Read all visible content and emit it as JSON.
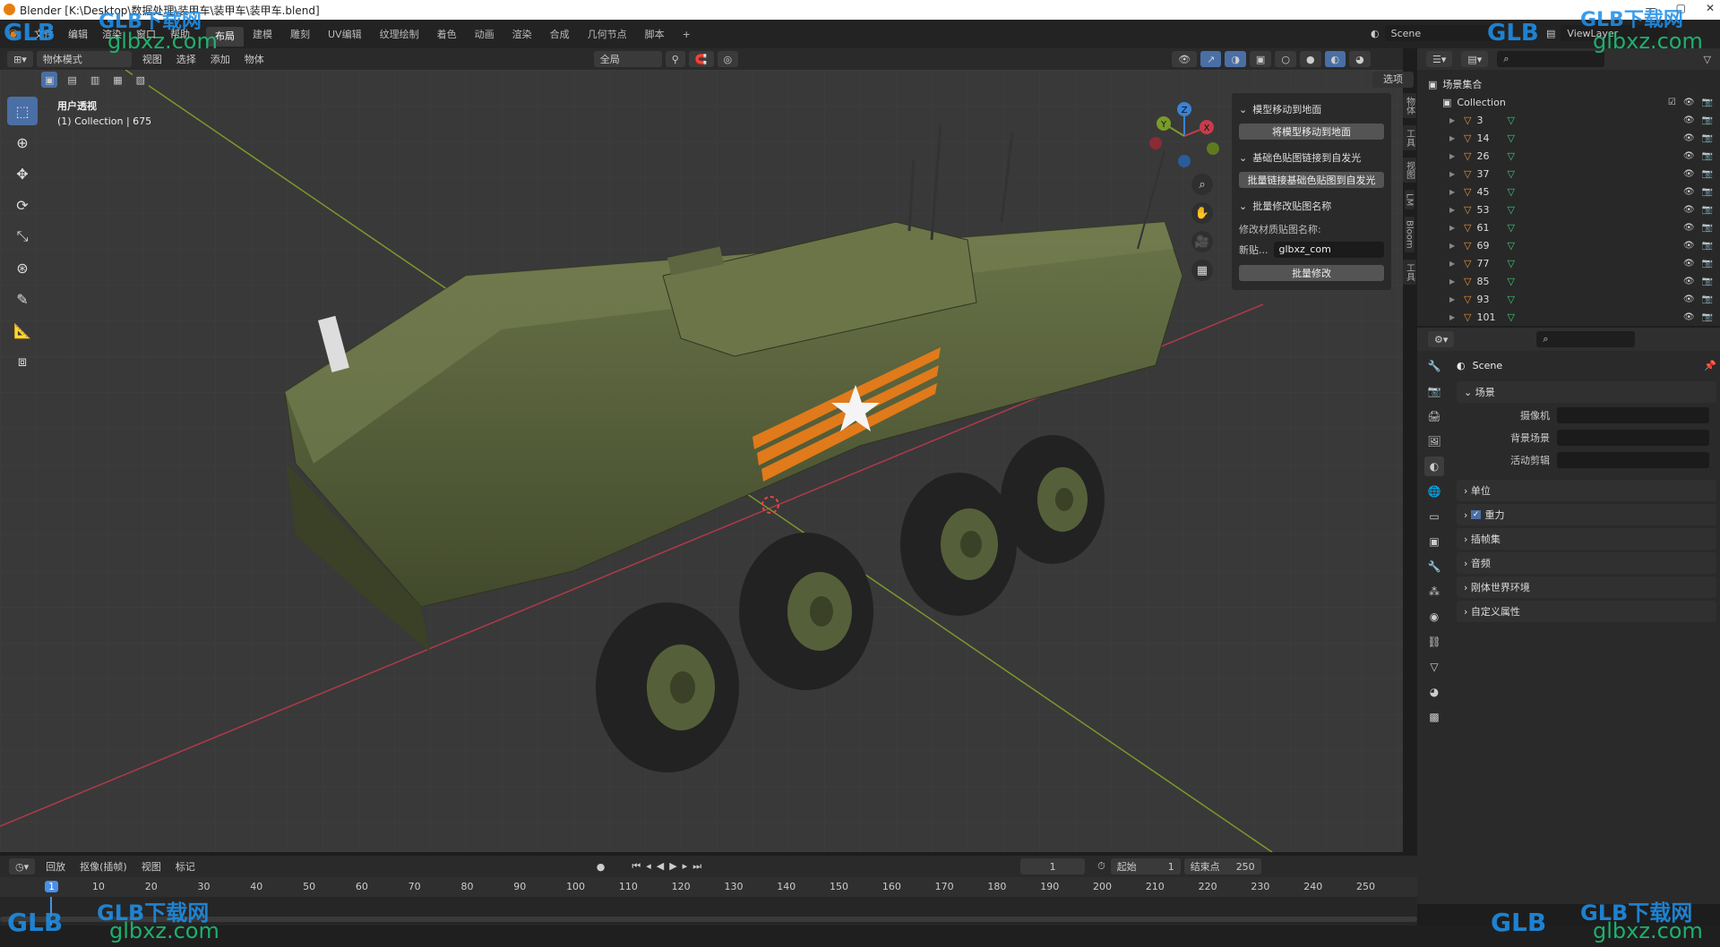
{
  "window": {
    "title": "Blender [K:\\Desktop\\数据处理\\装甲车\\装甲车\\装甲车.blend]"
  },
  "menu": [
    "文件",
    "编辑",
    "渲染",
    "窗口",
    "帮助"
  ],
  "workspaces": [
    "布局",
    "建模",
    "雕刻",
    "UV编辑",
    "纹理绘制",
    "着色",
    "动画",
    "渲染",
    "合成",
    "几何节点",
    "脚本"
  ],
  "active_workspace": "布局",
  "scene_selector": "Scene",
  "viewlayer_selector": "ViewLayer",
  "viewport_header": {
    "mode": "物体模式",
    "menus": [
      "视图",
      "选择",
      "添加",
      "物体"
    ],
    "transform": "全局",
    "options": "选项"
  },
  "viewport_info": {
    "line1": "用户透视",
    "line2": "(1) Collection | 675"
  },
  "gizmo_axes": [
    "X",
    "Y",
    "Z"
  ],
  "npanel": {
    "sec1": "模型移动到地面",
    "btn1": "将模型移动到地面",
    "sec2": "基础色贴图链接到自发光",
    "btn2": "批量链接基础色贴图到自发光",
    "sec3": "批量修改贴图名称",
    "label3": "修改材质贴图名称:",
    "field_label": "新贴...",
    "field_value": "glbxz_com",
    "btn3": "批量修改"
  },
  "vertical_tabs": [
    "物体",
    "工具",
    "视图",
    "LM",
    "Bloom",
    "工具"
  ],
  "outliner": {
    "root": "场景集合",
    "collection": "Collection",
    "items": [
      "3",
      "14",
      "26",
      "37",
      "45",
      "53",
      "61",
      "69",
      "77",
      "85",
      "93",
      "101"
    ]
  },
  "properties": {
    "title": "Scene",
    "section": "场景",
    "fields": [
      "摄像机",
      "背景场景",
      "活动剪辑"
    ],
    "subsections": [
      "单位",
      "重力",
      "插帧集",
      "音频",
      "刚体世界环境",
      "自定义属性"
    ]
  },
  "timeline": {
    "menus": [
      "回放",
      "抠像(插帧)",
      "视图",
      "标记"
    ],
    "current_frame": "1",
    "start_label": "起始",
    "start": "1",
    "end_label": "结束点",
    "end": "250",
    "ticks": [
      "1",
      "10",
      "20",
      "30",
      "40",
      "50",
      "60",
      "70",
      "80",
      "90",
      "100",
      "110",
      "120",
      "130",
      "140",
      "150",
      "160",
      "170",
      "180",
      "190",
      "200",
      "210",
      "220",
      "230",
      "240",
      "250"
    ]
  },
  "watermarks": {
    "brand": "GLB下载网",
    "domain": "glbxz.com",
    "logo": "GLB"
  },
  "colors": {
    "accent": "#4a6fa5",
    "active_frame": "#4a8fe8",
    "vehicle": "#55603a",
    "x_axis": "#c83c4a",
    "y_axis": "#7a9a2a"
  }
}
